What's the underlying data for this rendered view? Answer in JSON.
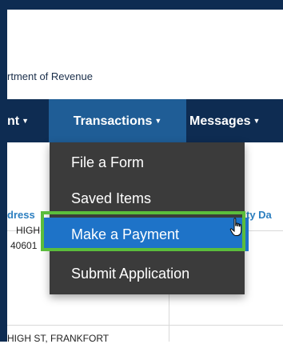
{
  "header": {
    "org_label": "rtment of Revenue"
  },
  "nav": {
    "items": [
      {
        "label": "nt"
      },
      {
        "label": "Transactions"
      },
      {
        "label": "Messages"
      }
    ]
  },
  "dropdown": {
    "items": [
      {
        "label": "File a Form"
      },
      {
        "label": "Saved Items"
      },
      {
        "label": "Make a Payment"
      },
      {
        "label": "Submit Application"
      }
    ]
  },
  "table": {
    "headers": [
      "dress",
      "ty Da"
    ],
    "cells": [
      "HIGH",
      "40601",
      "HIGH ST, FRANKFORT"
    ]
  },
  "colors": {
    "nav_bg": "#0e2c52",
    "nav_active_bg": "#1f5d96",
    "dropdown_bg": "#3b3b3b",
    "selected_item_bg": "#1e73c8",
    "highlight_border": "#5bbd3c",
    "table_header_text": "#2c7fc0"
  },
  "icons": {
    "caret": "caret-down-icon",
    "cursor": "hand-pointer-icon"
  }
}
